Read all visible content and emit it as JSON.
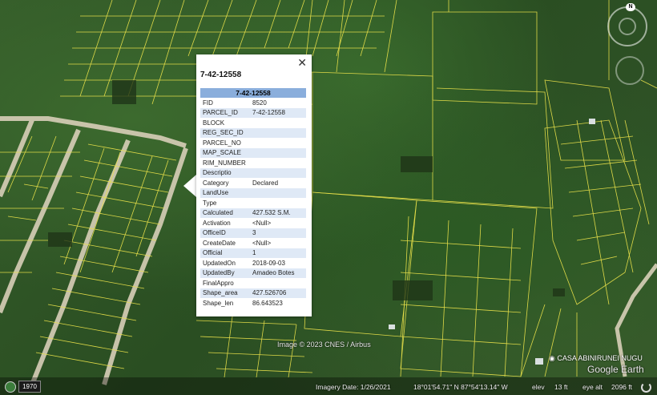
{
  "popup": {
    "title": "7-42-12558",
    "table_header": "7-42-12558",
    "close_label": "✕",
    "rows": [
      {
        "key": "FID",
        "value": "8520"
      },
      {
        "key": "PARCEL_ID",
        "value": "7-42-12558"
      },
      {
        "key": "BLOCK",
        "value": ""
      },
      {
        "key": "REG_SEC_ID",
        "value": ""
      },
      {
        "key": "PARCEL_NO",
        "value": ""
      },
      {
        "key": "MAP_SCALE",
        "value": ""
      },
      {
        "key": "RIM_NUMBER",
        "value": ""
      },
      {
        "key": "Descriptio",
        "value": ""
      },
      {
        "key": "Category",
        "value": "Declared"
      },
      {
        "key": "LandUse",
        "value": ""
      },
      {
        "key": "Type",
        "value": ""
      },
      {
        "key": "Calculated",
        "value": "427.532 S.M."
      },
      {
        "key": "Activation",
        "value": "<Null>"
      },
      {
        "key": "OfficeID",
        "value": "3"
      },
      {
        "key": "CreateDate",
        "value": "<Null>"
      },
      {
        "key": "Official",
        "value": "1"
      },
      {
        "key": "UpdatedOn",
        "value": "2018-09-03"
      },
      {
        "key": "UpdatedBy",
        "value": "Amadeo Botes"
      },
      {
        "key": "FinalAppro",
        "value": ""
      },
      {
        "key": "Shape_area",
        "value": "427.526706"
      },
      {
        "key": "Shape_len",
        "value": "86.643523"
      }
    ]
  },
  "map": {
    "copyright": "Image © 2023 CNES / Airbus",
    "place_label": "CASA ABINIRUNEI NUGU",
    "logo": "Google Earth",
    "compass_north": "N"
  },
  "status": {
    "year": "1970",
    "imagery_date": "Imagery Date: 1/26/2021",
    "coords": "18°01'54.71\" N   87°54'13.14\" W",
    "elev_label": "elev",
    "elev_value": "13 ft",
    "eye_alt_label": "eye alt",
    "eye_alt_value": "2096 ft"
  },
  "colors": {
    "parcel_line": "#e8e04a",
    "road": "#d6cdb8",
    "table_header_bg": "#8aaedc",
    "table_row_alt": "#dfe9f6"
  }
}
